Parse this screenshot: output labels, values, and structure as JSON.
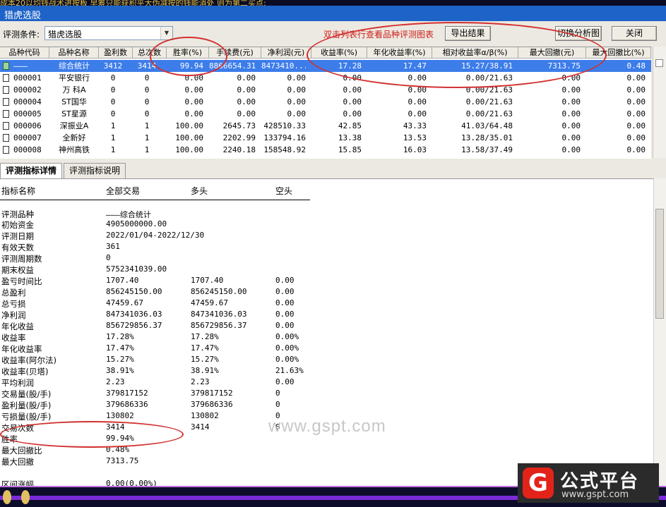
{
  "window": {
    "title": "猎虎选股",
    "top_strip_text": "成本20以均钱战术进按板  早筹只能获积平大伪减按的钱能消处  则为第二买点:"
  },
  "toolbar": {
    "condition_label": "评测条件:",
    "condition_value": "猎虎选股",
    "hint": "双击列表行查看品种评测图表",
    "export_button": "导出结果",
    "switch_button": "切换分析图",
    "close_button": "关闭"
  },
  "table": {
    "columns": [
      "品种代码",
      "品种名称",
      "盈利数",
      "总次数",
      "胜率(%)",
      "手续费(元)",
      "净利润(元)",
      "收益率(%)",
      "年化收益率(%)",
      "相对收益率α/β(%)",
      "最大回撤(元)",
      "最大回撤比(%)"
    ],
    "rows": [
      {
        "code": "———",
        "name": "综合统计",
        "wins": "3412",
        "total": "3414",
        "winrate": "99.94",
        "fee": "8866654.31",
        "profit": "8473410...",
        "ret": "17.28",
        "annual": "17.47",
        "rel": "15.27/38.91",
        "maxdd": "7313.75",
        "ddratio": "0.48",
        "selected": true
      },
      {
        "code": "000001",
        "name": "平安银行",
        "wins": "0",
        "total": "0",
        "winrate": "0.00",
        "fee": "0.00",
        "profit": "0.00",
        "ret": "0.00",
        "annual": "0.00",
        "rel": "0.00/21.63",
        "maxdd": "0.00",
        "ddratio": "0.00",
        "selected": false
      },
      {
        "code": "000002",
        "name": "万 科A",
        "wins": "0",
        "total": "0",
        "winrate": "0.00",
        "fee": "0.00",
        "profit": "0.00",
        "ret": "0.00",
        "annual": "0.00",
        "rel": "0.00/21.63",
        "maxdd": "0.00",
        "ddratio": "0.00",
        "selected": false
      },
      {
        "code": "000004",
        "name": "ST国华",
        "wins": "0",
        "total": "0",
        "winrate": "0.00",
        "fee": "0.00",
        "profit": "0.00",
        "ret": "0.00",
        "annual": "0.00",
        "rel": "0.00/21.63",
        "maxdd": "0.00",
        "ddratio": "0.00",
        "selected": false
      },
      {
        "code": "000005",
        "name": "ST星源",
        "wins": "0",
        "total": "0",
        "winrate": "0.00",
        "fee": "0.00",
        "profit": "0.00",
        "ret": "0.00",
        "annual": "0.00",
        "rel": "0.00/21.63",
        "maxdd": "0.00",
        "ddratio": "0.00",
        "selected": false
      },
      {
        "code": "000006",
        "name": "深振业A",
        "wins": "1",
        "total": "1",
        "winrate": "100.00",
        "fee": "2645.73",
        "profit": "428510.33",
        "ret": "42.85",
        "annual": "43.33",
        "rel": "41.03/64.48",
        "maxdd": "0.00",
        "ddratio": "0.00",
        "selected": false
      },
      {
        "code": "000007",
        "name": "全新好",
        "wins": "1",
        "total": "1",
        "winrate": "100.00",
        "fee": "2202.99",
        "profit": "133794.16",
        "ret": "13.38",
        "annual": "13.53",
        "rel": "13.28/35.01",
        "maxdd": "0.00",
        "ddratio": "0.00",
        "selected": false
      },
      {
        "code": "000008",
        "name": "神州高铁",
        "wins": "1",
        "total": "1",
        "winrate": "100.00",
        "fee": "2240.18",
        "profit": "158548.92",
        "ret": "15.85",
        "annual": "16.03",
        "rel": "13.58/37.49",
        "maxdd": "0.00",
        "ddratio": "0.00",
        "selected": false
      }
    ]
  },
  "tabs": [
    "评测指标详情",
    "评测指标说明"
  ],
  "details": {
    "headers": [
      "指标名称",
      "全部交易",
      "多头",
      "空头"
    ],
    "rows": [
      {
        "name": "评测品种",
        "all": "———综合统计",
        "long": "",
        "short": ""
      },
      {
        "name": "初始资金",
        "all": "4905000000.00",
        "long": "",
        "short": ""
      },
      {
        "name": "评测日期",
        "all": "2022/01/04-2022/12/30",
        "long": "",
        "short": ""
      },
      {
        "name": "有效天数",
        "all": "361",
        "long": "",
        "short": ""
      },
      {
        "name": "评测周期数",
        "all": "0",
        "long": "",
        "short": ""
      },
      {
        "name": "期末权益",
        "all": "5752341039.00",
        "long": "",
        "short": ""
      },
      {
        "name": "盈亏时间比",
        "all": "1707.40",
        "long": "1707.40",
        "short": "0.00"
      },
      {
        "name": "总盈利",
        "all": "856245150.00",
        "long": "856245150.00",
        "short": "0.00"
      },
      {
        "name": "总亏损",
        "all": "47459.67",
        "long": "47459.67",
        "short": "0.00"
      },
      {
        "name": "净利润",
        "all": "847341036.03",
        "long": "847341036.03",
        "short": "0.00"
      },
      {
        "name": "年化收益",
        "all": "856729856.37",
        "long": "856729856.37",
        "short": "0.00"
      },
      {
        "name": "收益率",
        "all": "17.28%",
        "long": "17.28%",
        "short": "0.00%"
      },
      {
        "name": "年化收益率",
        "all": "17.47%",
        "long": "17.47%",
        "short": "0.00%"
      },
      {
        "name": "收益率(阿尔法)",
        "all": "15.27%",
        "long": "15.27%",
        "short": "0.00%"
      },
      {
        "name": "收益率(贝塔)",
        "all": "38.91%",
        "long": "38.91%",
        "short": "21.63%"
      },
      {
        "name": "平均利润",
        "all": "2.23",
        "long": "2.23",
        "short": "0.00"
      },
      {
        "name": "交易量(股/手)",
        "all": "379817152",
        "long": "379817152",
        "short": "0"
      },
      {
        "name": "盈利量(股/手)",
        "all": "379686336",
        "long": "379686336",
        "short": "0"
      },
      {
        "name": "亏损量(股/手)",
        "all": "130802",
        "long": "130802",
        "short": "0"
      },
      {
        "name": "交易次数",
        "all": "3414",
        "long": "3414",
        "short": "0"
      },
      {
        "name": "胜率",
        "all": "99.94%",
        "long": "",
        "short": ""
      },
      {
        "name": "最大回撤比",
        "all": "0.48%",
        "long": "",
        "short": ""
      },
      {
        "name": "最大回撤",
        "all": "7313.75",
        "long": "",
        "short": ""
      },
      {
        "name": "区间涨幅",
        "all": "0.00(0.00%)",
        "long": "",
        "short": ""
      }
    ]
  },
  "watermark": {
    "site": "www.gspt.com",
    "logo_mark": "G",
    "logo_title": "公式平台",
    "logo_url": "www.gspt.com"
  },
  "colors": {
    "title_bar": "#1e63c8",
    "selected_row": "#3d7dea",
    "hint_red": "#d0201a",
    "annotation_red": "#d23030"
  }
}
